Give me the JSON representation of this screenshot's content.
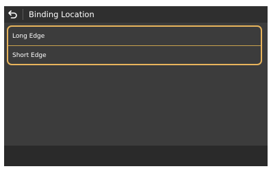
{
  "header": {
    "title": "Binding Location",
    "back_icon": "back-arrow-icon"
  },
  "options": [
    {
      "label": "Long Edge"
    },
    {
      "label": "Short Edge"
    }
  ],
  "colors": {
    "screen_bg": "#3c3c3c",
    "header_bg": "#2f2f2f",
    "footer_bg": "#2a2a2a",
    "highlight": "#e8b45c",
    "text": "#ffffff"
  }
}
